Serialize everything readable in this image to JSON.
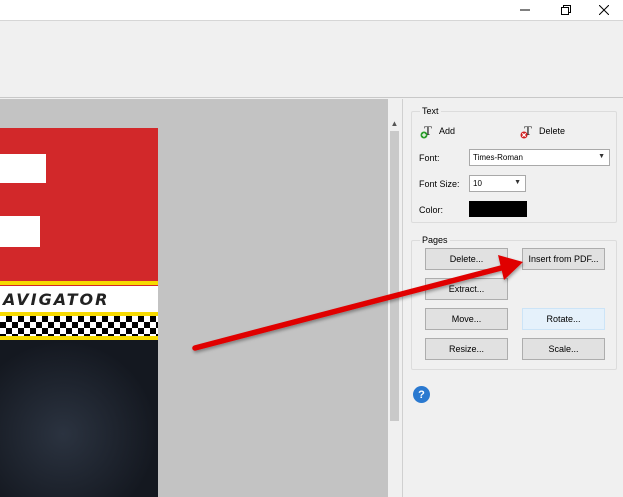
{
  "window": {
    "controls": {
      "minimize_icon": "minimize-icon",
      "restore_icon": "restore-icon",
      "close_icon": "close-icon"
    }
  },
  "document_preview": {
    "banner_text": "AVIGATOR",
    "colors": {
      "brand_red": "#d2282a",
      "stripe_yellow": "#f6da00"
    }
  },
  "text_group": {
    "title": "Text",
    "add_label": "Add",
    "delete_label": "Delete",
    "font_label": "Font:",
    "font_value": "Times-Roman",
    "font_size_label": "Font Size:",
    "font_size_value": "10",
    "color_label": "Color:",
    "color_value": "#000000"
  },
  "pages_group": {
    "title": "Pages",
    "delete_label": "Delete...",
    "insert_label": "Insert from PDF...",
    "extract_label": "Extract...",
    "move_label": "Move...",
    "rotate_label": "Rotate...",
    "resize_label": "Resize...",
    "scale_label": "Scale..."
  },
  "help": {
    "label": "?"
  },
  "annotation": {
    "type": "red-arrow",
    "points_to": "Insert from PDF...",
    "color": "#e00000"
  }
}
